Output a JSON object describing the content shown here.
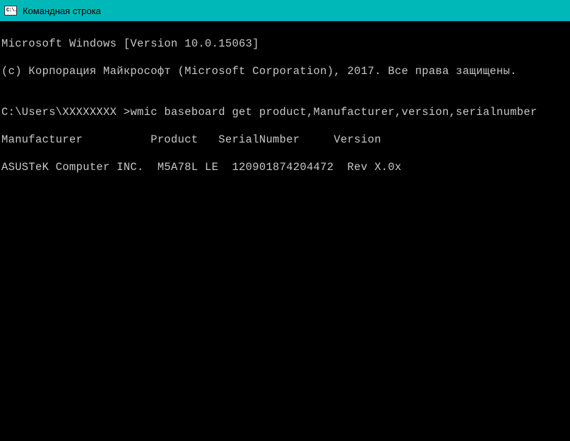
{
  "titlebar": {
    "icon_text": "C:\\.",
    "title": "Командная строка"
  },
  "terminal": {
    "line1": "Microsoft Windows [Version 10.0.15063]",
    "line2": "(c) Корпорация Майкрософт (Microsoft Corporation), 2017. Все права защищены.",
    "line3": "",
    "prompt": "C:\\Users\\XXXXXXXX >",
    "command": "wmic baseboard get product,Manufacturer,version,serialnumber",
    "header_row": "Manufacturer          Product   SerialNumber     Version",
    "data_row": "ASUSTeK Computer INC.  M5A78L LE  120901874204472  Rev X.0x"
  }
}
